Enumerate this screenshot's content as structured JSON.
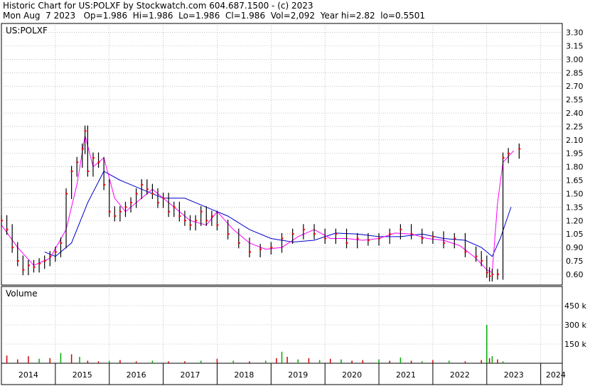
{
  "header": {
    "line1": "Historic Chart for US:POLXF by Stockwatch.com 604.687.1500 - (c) 2023",
    "line2": "Mon Aug  7 2023   Op=1.986  Hi=1.986  Lo=1.986  Cl=1.986  Vol=2,092  Year hi=2.82  lo=0.5501"
  },
  "colors": {
    "candle": "#000000",
    "close_dot": "#ff0000",
    "ma_short": "#ff00ff",
    "ma_long": "#0000cc",
    "volume_up": "#00aa00",
    "volume_down": "#cc0000",
    "grid": "#9a9a9a"
  },
  "chart_data": [
    {
      "type": "line",
      "title": "US:POLXF",
      "ylim": [
        0.48,
        3.4
      ],
      "y_ticks": [
        "3.30",
        "3.15",
        "3.00",
        "2.85",
        "2.70",
        "2.55",
        "2.40",
        "2.25",
        "2.10",
        "1.95",
        "1.80",
        "1.65",
        "1.50",
        "1.35",
        "1.20",
        "1.05",
        "0.90",
        "0.75",
        "0.60"
      ],
      "x_ticks": [
        "2014",
        "2015",
        "2016",
        "2017",
        "2018",
        "2019",
        "2020",
        "2021",
        "2022",
        "2023",
        "2024"
      ],
      "xlim": [
        2014.0,
        2024.4
      ],
      "grid": true,
      "series": [
        {
          "kind": "price",
          "x": [
            2014.0,
            2014.1,
            2014.2,
            2014.3,
            2014.4,
            2014.5,
            2014.6,
            2014.7,
            2014.8,
            2014.9,
            2015.0,
            2015.1,
            2015.2,
            2015.3,
            2015.4,
            2015.5,
            2015.55,
            2015.6,
            2015.7,
            2015.8,
            2015.9,
            2016.0,
            2016.1,
            2016.2,
            2016.3,
            2016.4,
            2016.5,
            2016.6,
            2016.7,
            2016.8,
            2016.9,
            2017.0,
            2017.1,
            2017.2,
            2017.3,
            2017.4,
            2017.5,
            2017.6,
            2017.7,
            2017.8,
            2017.9,
            2018.0,
            2018.2,
            2018.4,
            2018.6,
            2018.8,
            2019.0,
            2019.2,
            2019.4,
            2019.6,
            2019.8,
            2020.0,
            2020.2,
            2020.4,
            2020.6,
            2020.8,
            2021.0,
            2021.2,
            2021.4,
            2021.6,
            2021.8,
            2022.0,
            2022.2,
            2022.4,
            2022.6,
            2022.8,
            2022.9,
            2023.0,
            2023.05,
            2023.1,
            2023.2,
            2023.3,
            2023.4,
            2023.6
          ],
          "values": [
            1.2,
            1.1,
            0.9,
            0.75,
            0.65,
            0.7,
            0.68,
            0.72,
            0.75,
            0.8,
            0.85,
            0.95,
            1.5,
            1.75,
            1.85,
            2.0,
            2.2,
            1.75,
            1.9,
            1.85,
            1.6,
            1.3,
            1.25,
            1.3,
            1.35,
            1.4,
            1.5,
            1.6,
            1.55,
            1.5,
            1.4,
            1.45,
            1.3,
            1.35,
            1.25,
            1.2,
            1.15,
            1.2,
            1.3,
            1.2,
            1.25,
            1.15,
            1.05,
            0.95,
            0.85,
            0.88,
            0.9,
            1.0,
            1.05,
            1.1,
            1.05,
            1.0,
            1.05,
            0.95,
            1.0,
            0.98,
            1.0,
            1.05,
            1.1,
            1.05,
            1.0,
            1.02,
            0.95,
            1.0,
            0.85,
            0.8,
            0.75,
            0.62,
            0.58,
            0.6,
            0.6,
            1.9,
            1.95,
            2.0
          ]
        },
        {
          "kind": "moving-average-short",
          "x": [
            2014.0,
            2014.3,
            2014.6,
            2014.9,
            2015.2,
            2015.4,
            2015.55,
            2015.7,
            2015.9,
            2016.1,
            2016.3,
            2016.6,
            2016.8,
            2017.0,
            2017.2,
            2017.5,
            2017.8,
            2018.0,
            2018.3,
            2018.6,
            2018.9,
            2019.2,
            2019.5,
            2019.8,
            2020.1,
            2020.4,
            2020.7,
            2021.0,
            2021.3,
            2021.6,
            2021.9,
            2022.2,
            2022.5,
            2022.8,
            2023.0,
            2023.1,
            2023.2,
            2023.3,
            2023.5
          ],
          "values": [
            1.15,
            0.9,
            0.7,
            0.78,
            1.1,
            1.6,
            2.15,
            1.8,
            1.9,
            1.45,
            1.3,
            1.45,
            1.55,
            1.45,
            1.35,
            1.2,
            1.15,
            1.3,
            1.1,
            0.95,
            0.88,
            0.9,
            1.02,
            1.1,
            1.0,
            1.0,
            0.98,
            1.0,
            1.06,
            1.05,
            1.0,
            0.98,
            0.92,
            0.78,
            0.65,
            0.62,
            1.4,
            1.85,
            1.98
          ]
        },
        {
          "kind": "moving-average-long",
          "x": [
            2014.8,
            2015.0,
            2015.3,
            2015.6,
            2015.9,
            2016.2,
            2016.6,
            2017.0,
            2017.4,
            2017.8,
            2018.2,
            2018.6,
            2019.0,
            2019.4,
            2019.8,
            2020.2,
            2020.6,
            2021.0,
            2021.4,
            2021.8,
            2022.2,
            2022.6,
            2022.9,
            2023.0,
            2023.1,
            2023.25,
            2023.45
          ],
          "values": [
            0.85,
            0.8,
            0.95,
            1.4,
            1.75,
            1.65,
            1.55,
            1.45,
            1.45,
            1.35,
            1.25,
            1.1,
            1.0,
            0.96,
            0.98,
            1.06,
            1.05,
            1.02,
            1.02,
            1.05,
            1.0,
            0.98,
            0.9,
            0.85,
            0.8,
            1.0,
            1.35
          ]
        }
      ]
    },
    {
      "type": "bar",
      "title": "Volume",
      "y_ticks": [
        "450 k",
        "300 k",
        "150 k"
      ],
      "ylim": [
        0,
        600
      ],
      "x": [
        2014.1,
        2014.3,
        2014.5,
        2014.7,
        2014.9,
        2015.1,
        2015.3,
        2015.45,
        2015.6,
        2015.8,
        2016.0,
        2016.2,
        2016.5,
        2016.8,
        2017.1,
        2017.4,
        2017.7,
        2018.0,
        2018.3,
        2018.6,
        2018.9,
        2019.1,
        2019.2,
        2019.3,
        2019.5,
        2019.7,
        2019.9,
        2020.1,
        2020.3,
        2020.5,
        2020.7,
        2021.0,
        2021.2,
        2021.4,
        2021.6,
        2021.8,
        2022.0,
        2022.3,
        2022.6,
        2022.9,
        2023.0,
        2023.05,
        2023.1,
        2023.2,
        2023.3
      ],
      "values": [
        60,
        30,
        55,
        35,
        40,
        80,
        70,
        50,
        20,
        15,
        20,
        25,
        15,
        20,
        15,
        15,
        20,
        35,
        20,
        15,
        20,
        40,
        90,
        50,
        30,
        40,
        25,
        35,
        30,
        20,
        25,
        30,
        20,
        45,
        20,
        15,
        25,
        20,
        15,
        25,
        300,
        40,
        55,
        30,
        15
      ],
      "up": [
        0,
        0,
        0,
        1,
        0,
        1,
        0,
        1,
        0,
        0,
        1,
        0,
        0,
        1,
        0,
        0,
        1,
        0,
        1,
        0,
        1,
        0,
        1,
        0,
        1,
        0,
        1,
        0,
        1,
        0,
        0,
        1,
        0,
        1,
        0,
        1,
        0,
        1,
        0,
        0,
        1,
        0,
        1,
        0,
        1
      ]
    }
  ]
}
